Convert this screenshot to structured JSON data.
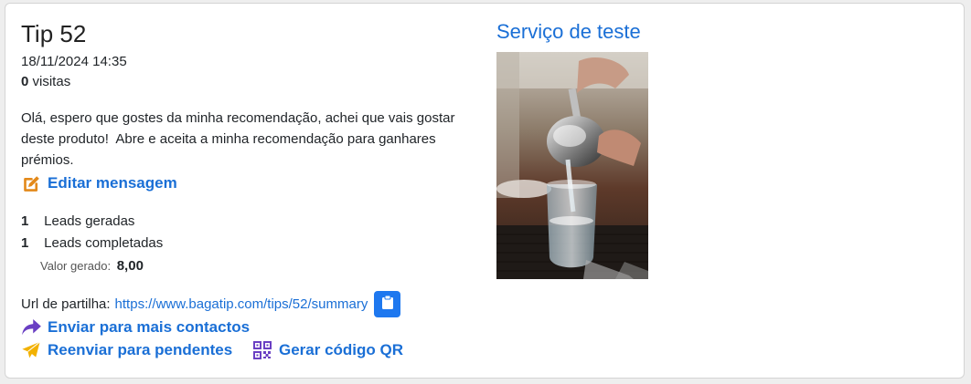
{
  "tip": {
    "title": "Tip 52",
    "datetime": "18/11/2024 14:35",
    "visits_count": "0",
    "visits_label": "visitas",
    "message": "Olá, espero que gostes da minha recomendação, achei que vais gostar deste produto!  Abre e aceita a minha recomendação para ganhares prémios.",
    "edit_label": "Editar mensagem"
  },
  "stats": [
    {
      "count": "1",
      "label": "Leads geradas"
    },
    {
      "count": "1",
      "label": "Leads completadas"
    }
  ],
  "value": {
    "label": "Valor gerado:",
    "amount": "8,00"
  },
  "share": {
    "label": "Url de partilha:",
    "url": "https://www.bagatip.com/tips/52/summary"
  },
  "actions": {
    "send_more": "Enviar para mais contactos",
    "resend_pending": "Reenviar para pendentes",
    "qr_code": "Gerar código QR"
  },
  "service": {
    "name": "Serviço de teste"
  },
  "icons": {
    "edit": "edit-icon",
    "copy": "clipboard-icon",
    "share": "share-arrow-icon",
    "send": "paper-plane-icon",
    "qr": "qrcode-icon"
  },
  "colors": {
    "link": "#1a6fd6",
    "edit_icon": "#e3891a",
    "share_icon": "#6a3fc3",
    "send_icon": "#f2b100",
    "qr_icon": "#6a3fc3",
    "copy_button": "#1e78ef"
  }
}
